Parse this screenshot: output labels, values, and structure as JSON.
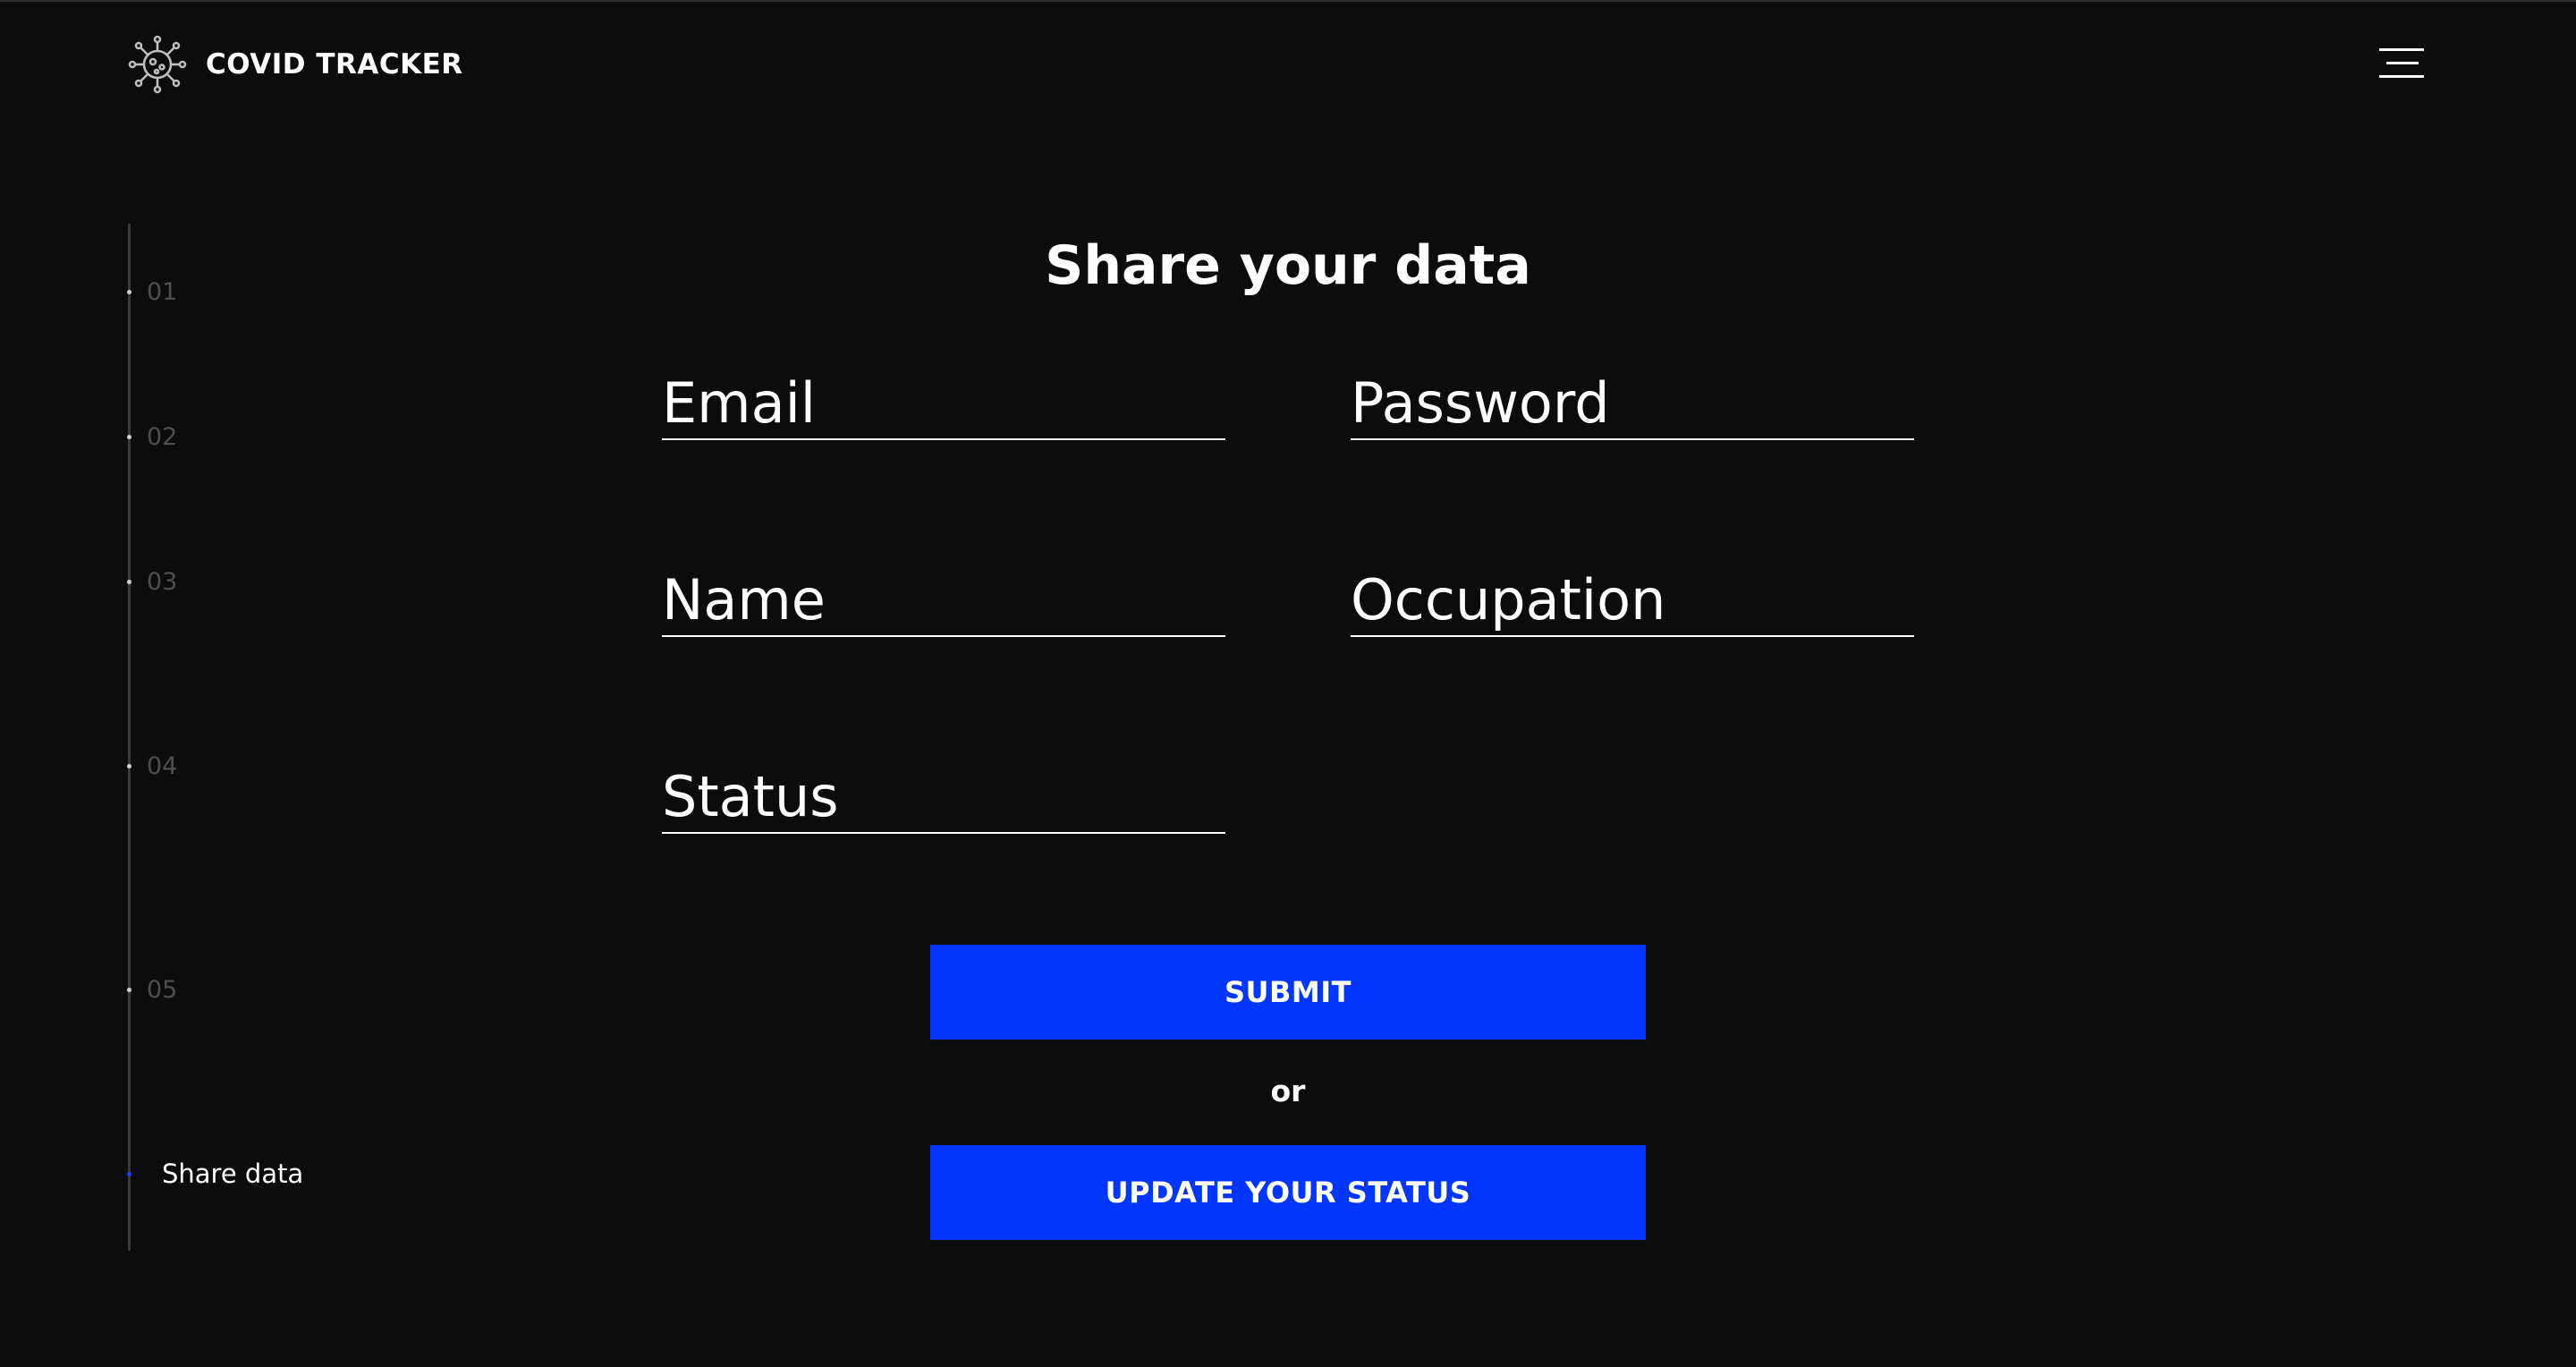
{
  "header": {
    "brand": "COVID TRACKER",
    "logo_icon": "virus-icon",
    "menu_icon": "hamburger-menu-icon"
  },
  "sidenav": {
    "items": [
      {
        "label": "01"
      },
      {
        "label": "02"
      },
      {
        "label": "03"
      },
      {
        "label": "04"
      },
      {
        "label": "05"
      },
      {
        "label": "Share data",
        "active": true
      }
    ]
  },
  "form": {
    "title": "Share your data",
    "fields": {
      "email": {
        "placeholder": "Email",
        "value": ""
      },
      "password": {
        "placeholder": "Password",
        "value": ""
      },
      "name": {
        "placeholder": "Name",
        "value": ""
      },
      "occupation": {
        "placeholder": "Occupation",
        "value": ""
      },
      "status": {
        "placeholder": "Status",
        "value": ""
      }
    },
    "submit_label": "SUBMIT",
    "or_label": "or",
    "update_label": "UPDATE YOUR STATUS"
  },
  "colors": {
    "background": "#0c0c0c",
    "accent": "#0236ff",
    "muted_text": "#4e4e4e",
    "text": "#ffffff"
  }
}
